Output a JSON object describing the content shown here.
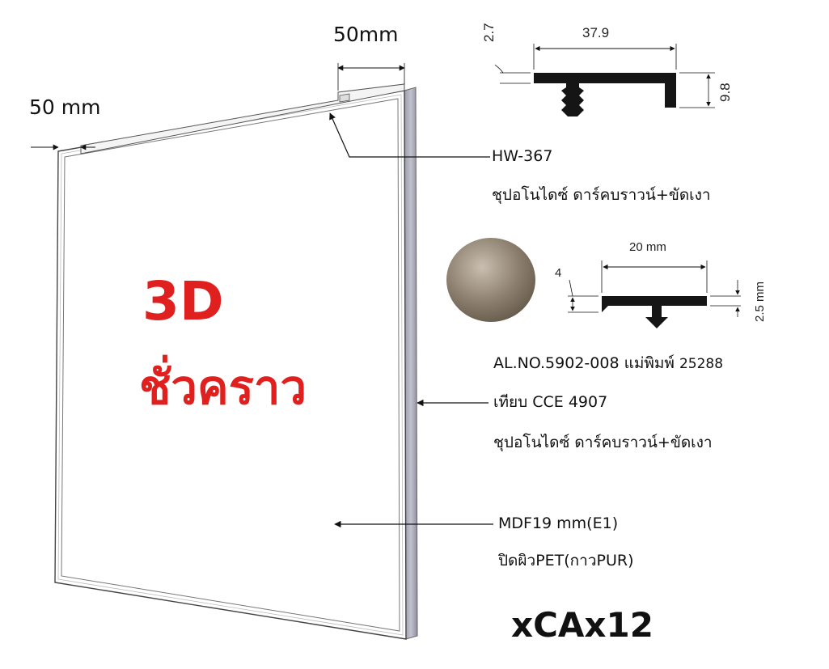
{
  "dimensions": {
    "top_width": "50mm",
    "left_width": "50 mm"
  },
  "profile_hw367": {
    "width": "37.9",
    "lip": "2.7",
    "height": "9.8"
  },
  "profile_al": {
    "width": "20 mm",
    "height": "4",
    "lip": "2.5 mm"
  },
  "callouts": {
    "hw_code": "HW-367",
    "hw_finish": "ชุปอโนไดซ์ ดาร์คบราวน์+ขัดเงา",
    "al_code": "AL.NO.5902-008 แม่พิมพ์",
    "al_mold": "25288",
    "edge_code": "เทียบ CCE 4907",
    "edge_finish": "ชุปอโนไดซ์ ดาร์คบราวน์+ขัดเงา",
    "board_spec": "MDF19 mm(E1)",
    "board_surface": "ปิดผิวPET(กาวPUR)"
  },
  "panel_label": {
    "line1": "3D",
    "line2": "ชั่วคราว",
    "color": "#e0201e"
  },
  "model_code": "xCAx12",
  "swatch_color": "#8c7f6e"
}
